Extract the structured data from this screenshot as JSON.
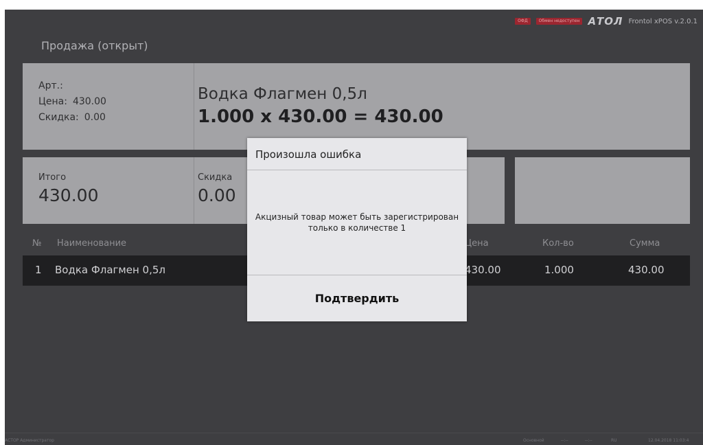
{
  "topbar": {
    "badge_ofd": "ОФД",
    "badge_exchange": "Обмен недоступен",
    "brand": "АТОЛ",
    "version": "Frontol xPOS v.2.0.1"
  },
  "status_title": "Продажа (открыт)",
  "item": {
    "article_label": "Арт.:",
    "price_label": "Цена:",
    "price_value": "430.00",
    "discount_label": "Скидка:",
    "discount_value": "0.00",
    "name": "Водка Флагмен 0,5л",
    "calc": "1.000 х 430.00 = 430.00"
  },
  "totals": {
    "total_label": "Итого",
    "total_value": "430.00",
    "discount_label": "Скидка",
    "discount_value": "0.00"
  },
  "table": {
    "headers": [
      "№",
      "Наименование",
      "Цена",
      "Кол-во",
      "Сумма"
    ],
    "rows": [
      {
        "num": "1",
        "name": "Водка Флагмен 0,5л",
        "price": "430.00",
        "qty": "1.000",
        "sum": "430.00"
      }
    ]
  },
  "modal": {
    "title": "Произошла ошибка",
    "message": "Акцизный товар может быть зарегистрирован только в количестве 1",
    "confirm": "Подтвердить"
  },
  "footer": {
    "user": "АСТОР Администратор",
    "mode": "Основной",
    "time1": "--:--",
    "time2": "--:--",
    "lang": "RU",
    "datetime": "12.04.2018 11:03:4"
  }
}
